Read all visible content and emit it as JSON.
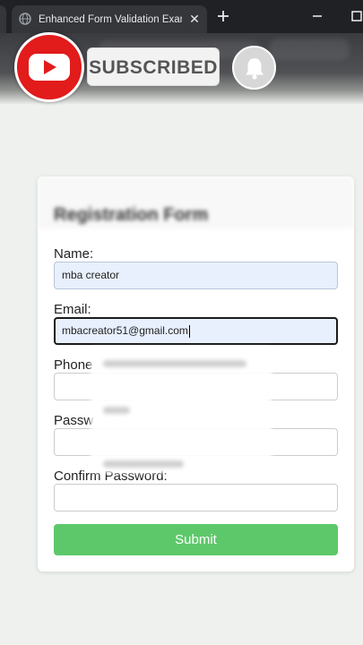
{
  "browser": {
    "tab_title": "Enhanced Form Validation Example",
    "close_tab": "✕",
    "new_tab": "+"
  },
  "overlay": {
    "subscribe_label": "SUBSCRIBED"
  },
  "form": {
    "title": "Registration Form",
    "fields": [
      {
        "label": "Name:",
        "value": "mba creator"
      },
      {
        "label": "Email:",
        "value": "mbacreator51@gmail.com"
      },
      {
        "label": "Phone",
        "value": ""
      },
      {
        "label": "Passw",
        "value": ""
      },
      {
        "label": "Confirm Password:",
        "value": ""
      }
    ],
    "submit_label": "Submit"
  },
  "colors": {
    "submit": "#5dc86a",
    "autofill": "#e8f0fe",
    "youtube_red": "#e21b1b"
  }
}
